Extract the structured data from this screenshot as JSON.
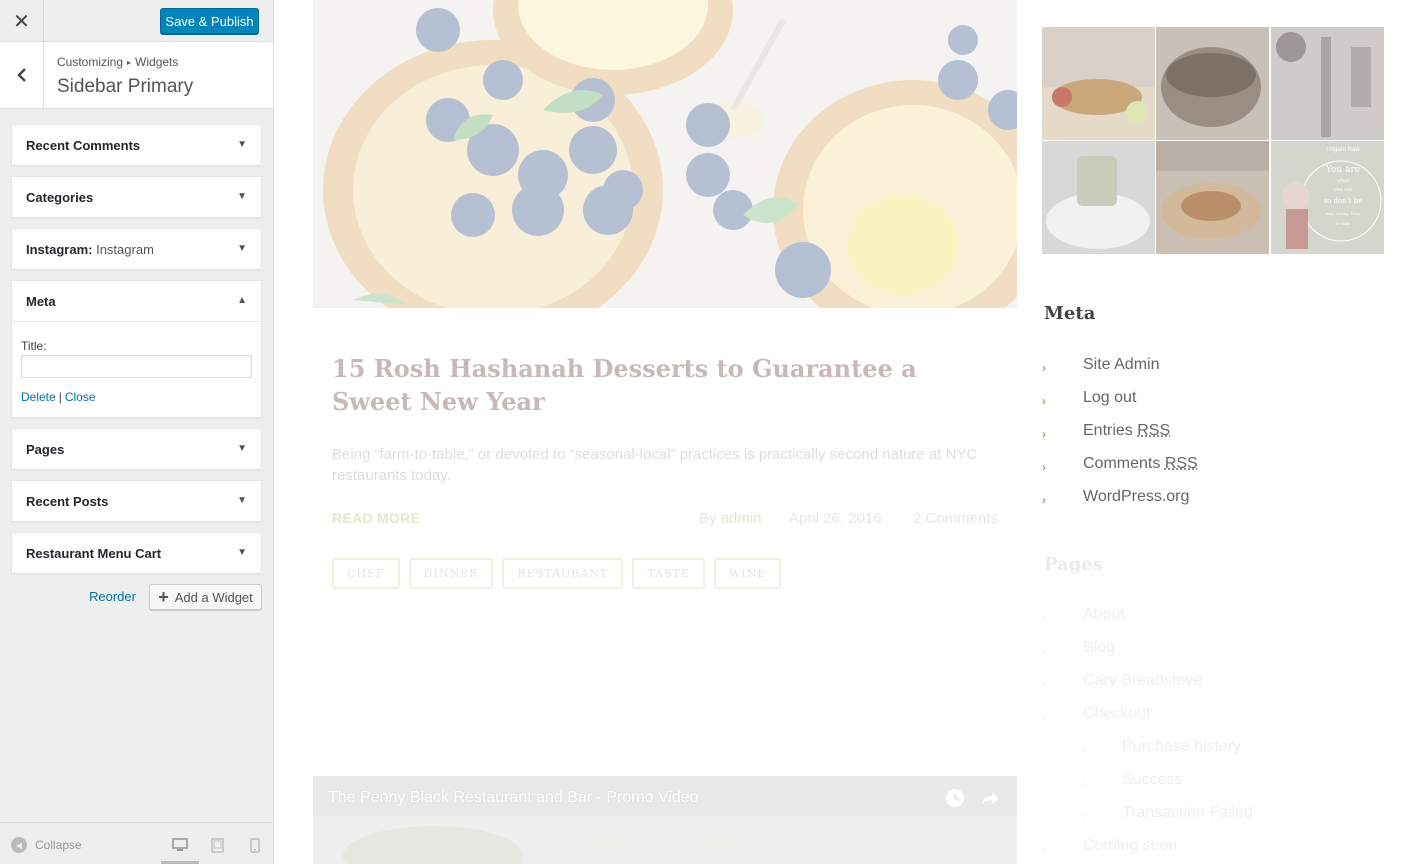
{
  "customizer": {
    "header": {
      "close_icon": "close-icon",
      "save_label": "Save & Publish"
    },
    "breadcrumb": {
      "root": "Customizing",
      "section": "Widgets"
    },
    "section_title": "Sidebar Primary",
    "widgets": [
      {
        "label": "Recent Comments",
        "expanded": false
      },
      {
        "label": "Categories",
        "expanded": false
      },
      {
        "label": "Instagram:",
        "instance": "Instagram",
        "expanded": false
      },
      {
        "label": "Meta",
        "expanded": true,
        "title_label": "Title:",
        "title_value": "",
        "delete_label": "Delete",
        "separator": "|",
        "close_label": "Close"
      },
      {
        "label": "Pages",
        "expanded": false
      },
      {
        "label": "Recent Posts",
        "expanded": false
      },
      {
        "label": "Restaurant Menu Cart",
        "expanded": false
      }
    ],
    "reorder_label": "Reorder",
    "add_widget_label": "Add a Widget",
    "footer": {
      "collapse_label": "Collapse",
      "devices": [
        "desktop",
        "tablet",
        "mobile"
      ],
      "active_device": "desktop"
    },
    "colors": {
      "primary": "#0085ba",
      "link": "#0073aa"
    }
  },
  "preview": {
    "post": {
      "title": "15 Rosh Hashanah Desserts to Guarantee a Sweet New Year",
      "excerpt": "Being “farm-to-table,” or devoted to “seasonal-local” practices is practically second nature at NYC restaurants today.",
      "read_more": "READ MORE",
      "by": "By",
      "author": "admin",
      "date": "April 26, 2016",
      "comments": "2 Comments",
      "tags": [
        "CHEF",
        "DINNER",
        "RESTAURANT",
        "TASTE",
        "WINE"
      ]
    },
    "video": {
      "title": "The Penny Black Restaurant and Bar - Promo Video"
    },
    "sidebar": {
      "instagram_caption": "Ungaro Raw",
      "instagram_overlay": [
        "You are",
        "what",
        "you eat",
        "so don't be",
        "fast, cheap, Easy",
        "or fake"
      ],
      "meta": {
        "title": "Meta",
        "items": [
          {
            "text": "Site Admin"
          },
          {
            "text": "Log out"
          },
          {
            "text": "Entries",
            "abbr": "RSS"
          },
          {
            "text": "Comments",
            "abbr": "RSS"
          },
          {
            "text": "WordPress.org"
          }
        ]
      },
      "pages": {
        "title": "Pages",
        "items": [
          "About",
          "Blog",
          "Cary Breadstove",
          "Checkout",
          "Purchase history",
          "Success",
          "Transaction Failed",
          "Coming soon"
        ]
      }
    }
  }
}
